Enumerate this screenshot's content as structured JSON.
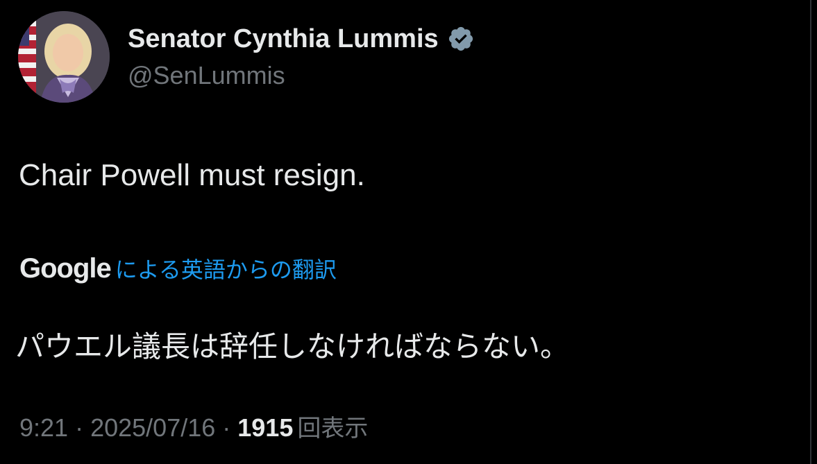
{
  "author": {
    "display_name": "Senator Cynthia Lummis",
    "handle": "@SenLummis",
    "verified_icon": "verified-badge-icon",
    "verified_color": "#829aab"
  },
  "tweet": {
    "text": "Chair Powell must resign."
  },
  "translation": {
    "provider": "Google",
    "label": "による英語からの翻訳",
    "text": "パウエル議長は辞任しなければならない。",
    "link_color": "#1d9bf0"
  },
  "meta": {
    "time": "9:21",
    "date": "2025/07/16",
    "separator": "·",
    "views_count": "1915",
    "views_label": "回表示"
  },
  "colors": {
    "background": "#000000",
    "primary_text": "#e7e9ea",
    "secondary_text": "#71767b"
  }
}
